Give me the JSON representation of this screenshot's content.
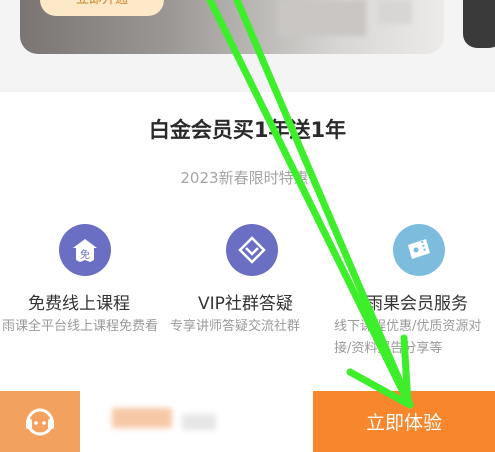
{
  "banner": {
    "button_label": "立即开通"
  },
  "promo": {
    "title": "白金会员买1年送1年",
    "subtitle": "2023新春限时特惠!"
  },
  "features": [
    {
      "icon": "free-course-icon",
      "icon_label": "免",
      "title": "免费线上课程",
      "desc": "雨课全平台线上课程免费看"
    },
    {
      "icon": "vip-community-icon",
      "title": "VIP社群答疑",
      "desc": "专享讲师答疑交流社群"
    },
    {
      "icon": "member-ticket-icon",
      "title": "雨果会员服务",
      "desc": "线下课程优惠/优质资源对接/资料报告分享等"
    }
  ],
  "bottom_bar": {
    "buy_label": "立即体验"
  },
  "colors": {
    "accent_orange": "#f7862c",
    "icon_purple": "#6b6fc4",
    "icon_blue": "#7dbcdc",
    "annotation_green": "#3dee2a"
  }
}
